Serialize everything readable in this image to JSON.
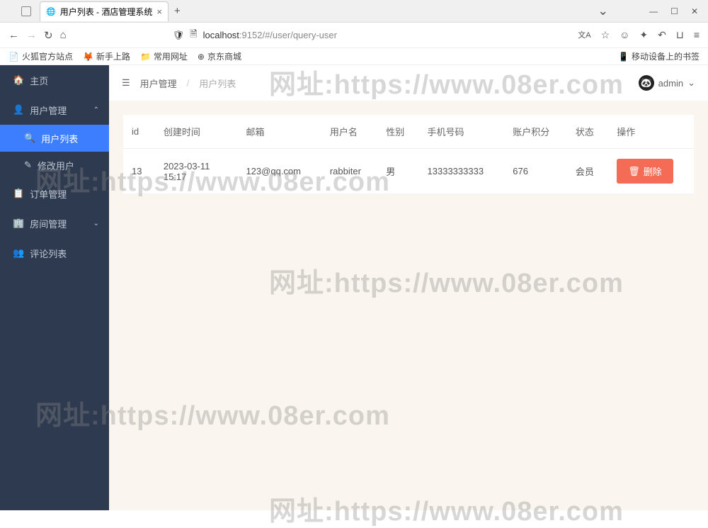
{
  "browser": {
    "tab_title": "用户列表 - 酒店管理系统",
    "url_host": "localhost",
    "url_port": ":9152",
    "url_path": "/#/user/query-user"
  },
  "bookmarks": {
    "b1": "火狐官方站点",
    "b2": "新手上路",
    "b3": "常用网址",
    "b4": "京东商城",
    "right": "移动设备上的书签"
  },
  "sidebar": {
    "home": "主页",
    "user_mgmt": "用户管理",
    "user_list": "用户列表",
    "edit_user": "修改用户",
    "order_mgmt": "订单管理",
    "room_mgmt": "房间管理",
    "comment_list": "评论列表"
  },
  "breadcrumb": {
    "a": "用户管理",
    "b": "用户列表"
  },
  "user": {
    "name": "admin"
  },
  "table": {
    "headers": {
      "id": "id",
      "created": "创建时间",
      "email": "邮箱",
      "username": "用户名",
      "gender": "性别",
      "phone": "手机号码",
      "points": "账户积分",
      "status": "状态",
      "ops": "操作"
    },
    "row": {
      "id": "13",
      "created": "2023-03-11 15:17",
      "email": "123@qq.com",
      "username": "rabbiter",
      "gender": "男",
      "phone": "13333333333",
      "points": "676",
      "status": "会员"
    },
    "delete": "删除"
  },
  "watermark": "网址:https://www.08er.com"
}
